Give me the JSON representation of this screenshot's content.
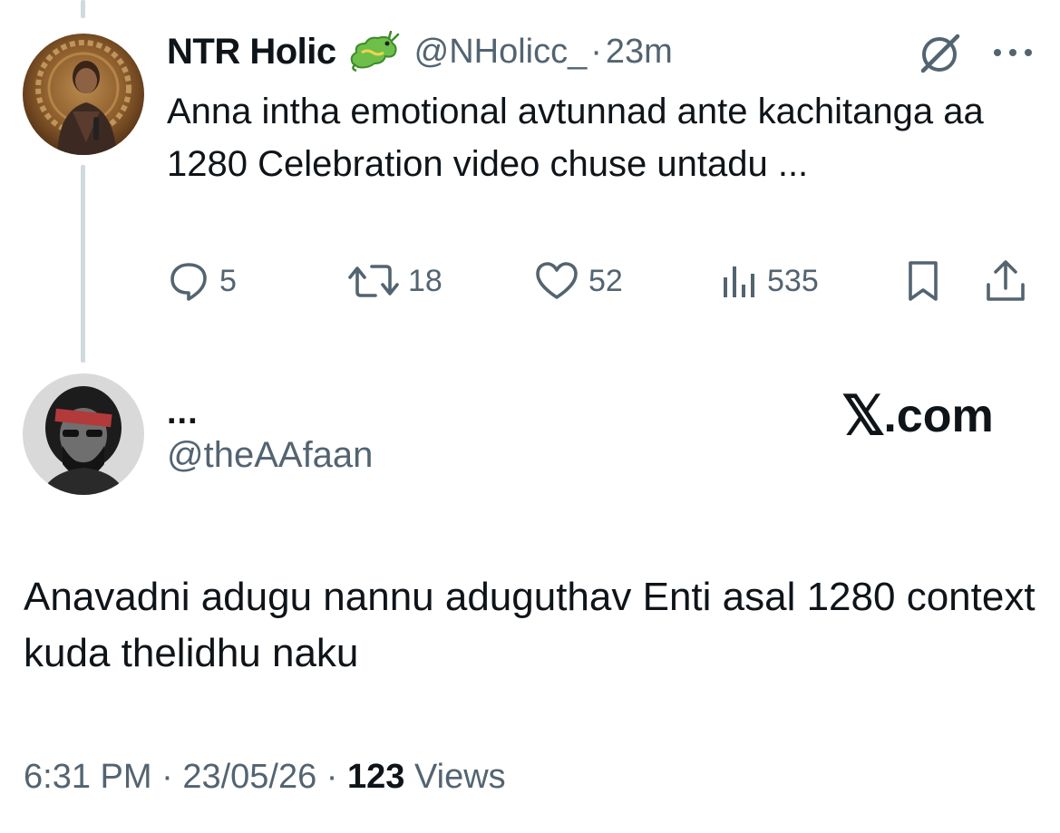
{
  "quoted_tweet": {
    "display_name": "NTR Holic",
    "handle": "@NHolicc_",
    "separator": "·",
    "time": "23m",
    "text": "Anna intha emotional avtunnad ante kachitanga aa 1280 Celebration video chuse untadu ...",
    "badge_icon": "dragon-emoji-icon",
    "stats": {
      "replies": "5",
      "retweets": "18",
      "likes": "52",
      "views": "535"
    }
  },
  "main_tweet": {
    "display_name": "...",
    "handle": "@theAAfaan",
    "watermark_x": "𝕏",
    "watermark_rest": ".com",
    "text": "Anavadni adugu nannu aduguthav Enti asal 1280 context kuda thelidhu naku",
    "time": "6:31 PM",
    "date": "23/05/26",
    "separator": "·",
    "views_count": "123",
    "views_label": "Views"
  },
  "colors": {
    "text_primary": "#0f1419",
    "text_secondary": "#536471",
    "thread_line": "#cfd9de",
    "background": "#ffffff"
  }
}
